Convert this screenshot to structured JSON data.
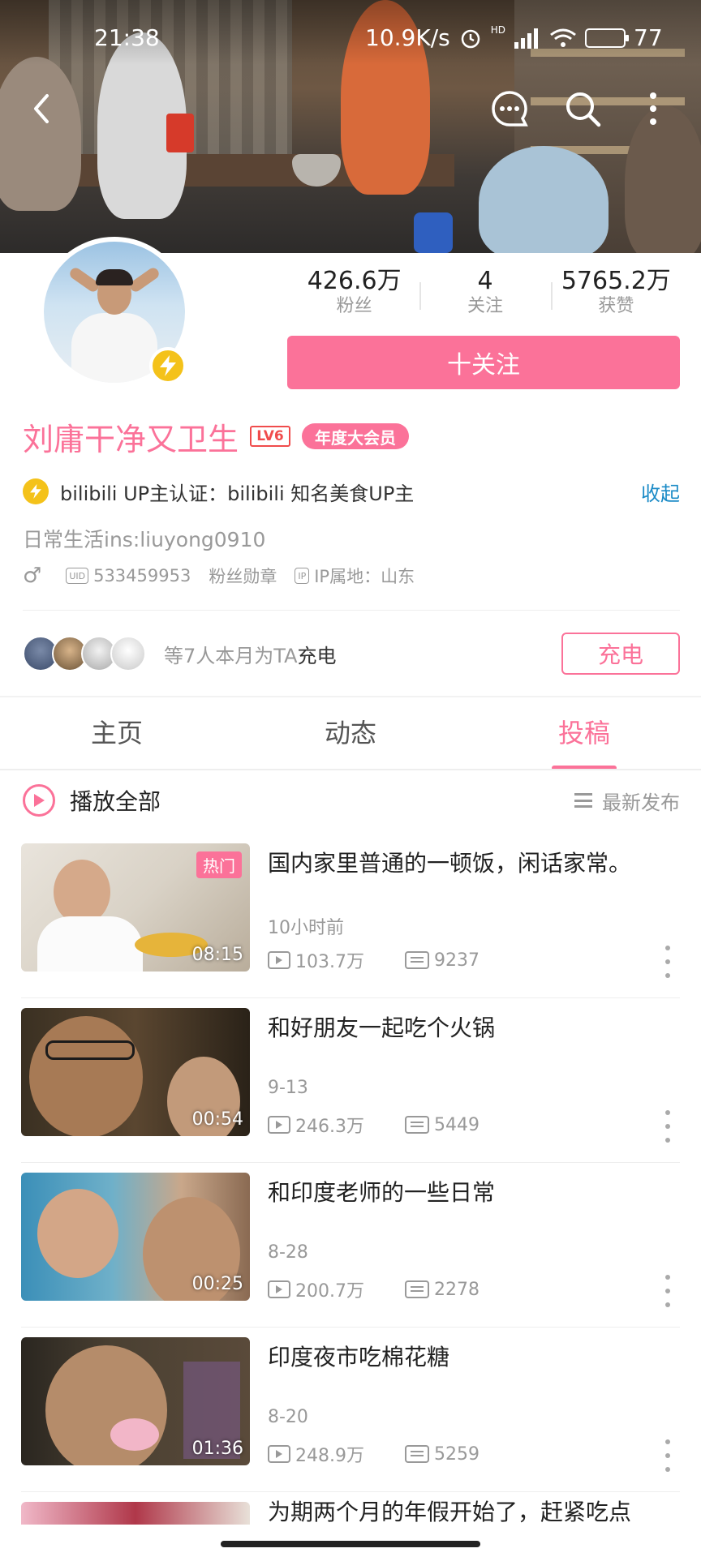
{
  "status": {
    "time": "21:38",
    "net_speed": "10.9K/s",
    "hd": "HD",
    "battery": "77"
  },
  "profile": {
    "stats": [
      {
        "value": "426.6万",
        "label": "粉丝"
      },
      {
        "value": "4",
        "label": "关注"
      },
      {
        "value": "5765.2万",
        "label": "获赞"
      }
    ],
    "follow_label": "十关注",
    "name": "刘庸干净又卫生",
    "level": "LV6",
    "vip_label": "年度大会员",
    "certification": "bilibili UP主认证：bilibili 知名美食UP主",
    "collapse_label": "收起",
    "bio": "日常生活ins:liuyong0910",
    "gender_symbol": "♂",
    "uid_tag": "UID",
    "uid": "533459953",
    "medal": "粉丝勋章",
    "ip_tag": "IP",
    "ip_location": "IP属地：山东"
  },
  "charge": {
    "text_prefix": "等7人本月为TA",
    "text_suffix": "充电",
    "button": "充电"
  },
  "tabs": [
    {
      "label": "主页"
    },
    {
      "label": "动态"
    },
    {
      "label": "投稿"
    }
  ],
  "playall": {
    "label": "播放全部",
    "sort_label": "最新发布"
  },
  "videos": [
    {
      "title": "国内家里普通的一顿饭，闲话家常。",
      "date": "10小时前",
      "views": "103.7万",
      "danmaku": "9237",
      "duration": "08:15",
      "badge": "热门"
    },
    {
      "title": "和好朋友一起吃个火锅",
      "date": "9-13",
      "views": "246.3万",
      "danmaku": "5449",
      "duration": "00:54"
    },
    {
      "title": "和印度老师的一些日常",
      "date": "8-28",
      "views": "200.7万",
      "danmaku": "2278",
      "duration": "00:25"
    },
    {
      "title": "印度夜市吃棉花糖",
      "date": "8-20",
      "views": "248.9万",
      "danmaku": "5259",
      "duration": "01:36"
    },
    {
      "title": "为期两个月的年假开始了，赶紧吃点"
    }
  ],
  "colors": {
    "accent": "#fb7299",
    "link": "#1b8bc7",
    "bolt": "#f4c21a"
  }
}
